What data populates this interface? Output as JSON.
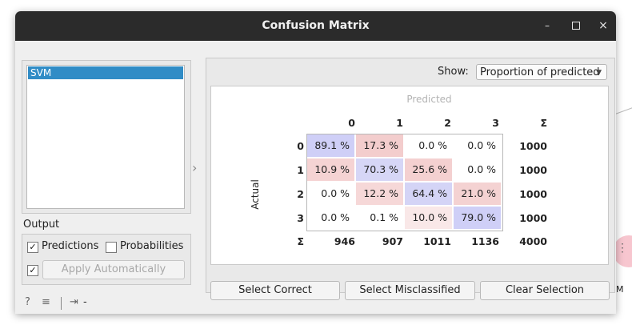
{
  "window": {
    "title": "Confusion Matrix",
    "controls": {
      "minimize": "–",
      "close": "×"
    }
  },
  "learners": {
    "items": [
      "SVM"
    ]
  },
  "output": {
    "title": "Output",
    "predictions_label": "Predictions",
    "predictions_checked": true,
    "probabilities_label": "Probabilities",
    "probabilities_checked": false,
    "auto_checked": true,
    "apply_label": "Apply Automatically"
  },
  "show": {
    "label": "Show:",
    "value": "Proportion of predicted"
  },
  "matrix": {
    "predicted_label": "Predicted",
    "actual_label": "Actual",
    "sigma": "Σ",
    "col_headers": [
      "0",
      "1",
      "2",
      "3"
    ],
    "row_headers": [
      "0",
      "1",
      "2",
      "3"
    ],
    "cells": [
      [
        "89.1 %",
        "17.3 %",
        "0.0 %",
        "0.0 %"
      ],
      [
        "10.9 %",
        "70.3 %",
        "25.6 %",
        "0.0 %"
      ],
      [
        "0.0 %",
        "12.2 %",
        "64.4 %",
        "21.0 %"
      ],
      [
        "0.0 %",
        "0.1 %",
        "10.0 %",
        "79.0 %"
      ]
    ],
    "row_sums": [
      "1000",
      "1000",
      "1000",
      "1000"
    ],
    "col_sums": [
      "946",
      "907",
      "1011",
      "1136"
    ],
    "total": "4000",
    "colors": {
      "diagonal": [
        "#cfcff7",
        "#d6d6f6",
        "#d4d4f6",
        "#cfcff7"
      ],
      "off_diagonal": {
        "0-1": "#f3cdcd",
        "1-0": "#f5d3d3",
        "1-2": "#f4d0d0",
        "2-1": "#f6d8d8",
        "2-3": "#f4d2d2",
        "3-2": "#f9e8e8"
      }
    }
  },
  "buttons": {
    "select_correct": "Select Correct",
    "select_misclassified": "Select Misclassified",
    "clear_selection": "Clear Selection"
  },
  "footer": {
    "help_icon": "?",
    "report_icon": "≡",
    "output_text": "-"
  },
  "background": {
    "node_label": "M"
  }
}
